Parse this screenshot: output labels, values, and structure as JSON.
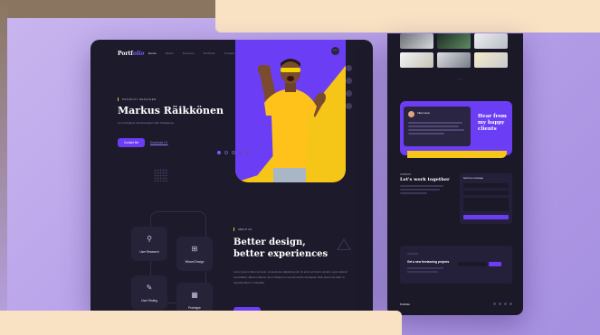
{
  "main": {
    "logo_text": "Portf",
    "logo_accent": "olio",
    "nav": [
      "Home",
      "About",
      "Services",
      "Portfolio",
      "Contact"
    ],
    "eyebrow": "PRODUCT DESIGNER",
    "name": "Markus Räikkönen",
    "subtitle": "Let a Designer and Developer with Intelligence",
    "primary_button": "Contact Me",
    "secondary_link": "Download CV",
    "services": [
      "User Research",
      "Wizard Design",
      "User Testing",
      "Prototype"
    ],
    "about_eyebrow": "ABOUT US",
    "about_heading_1": "Better design,",
    "about_heading_2": "better experiences",
    "about_text": "Lorem ipsum dolor sit amet, consectetur adipiscing elit. Ut enim ad minim veniam, quis nostrud exercitation ullamco laboris nisi ut aliquip ex ea commodo consequat. Duis aute irure dolor in reprehenderit in voluptate."
  },
  "side": {
    "testimonial_heading": "Hear from my happy clients",
    "testimonial_name": "Client name",
    "work_eyebrow": "CONTACT",
    "work_heading": "Let's work together",
    "form_title": "Send me a message",
    "newsletter_heading": "Get a new freelancing projects",
    "footer_logo": "Portfolio"
  },
  "colors": {
    "accent": "#6b3df5",
    "highlight": "#f5c518",
    "surface": "#1d1a2b"
  },
  "icons": {
    "menu": "menu-icon",
    "service_1": "user-research-icon",
    "service_2": "wizard-icon",
    "service_3": "user-testing-icon",
    "service_4": "prototype-icon"
  }
}
